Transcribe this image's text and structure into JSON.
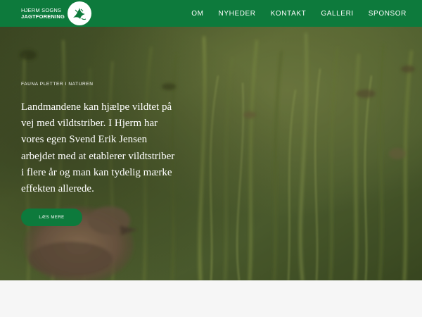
{
  "header": {
    "logo": {
      "line1": "HJERM SOGNS",
      "line2": "JAGTFORENING",
      "emblem": "bird-emblem-icon"
    },
    "nav": [
      {
        "label": "OM"
      },
      {
        "label": "NYHEDER"
      },
      {
        "label": "KONTAKT"
      },
      {
        "label": "GALLERI"
      },
      {
        "label": "SPONSOR"
      }
    ]
  },
  "hero": {
    "eyebrow": "FAUNA PLETTER I NATUREN",
    "headline": "Landmandene kan hjælpe vildtet på vej med vildtstriber. I Hjerm har vores egen Svend Erik Jensen arbejdet med at etablerer vildtstriber i flere år og man kan tydelig mærke effekten allerede.",
    "cta_label": "LÆS MERE",
    "background": "blurred-grass-bird-photo"
  },
  "colors": {
    "brand_green": "#0d7a3c",
    "text_white": "#ffffff",
    "page_bg": "#f6f6f6"
  }
}
